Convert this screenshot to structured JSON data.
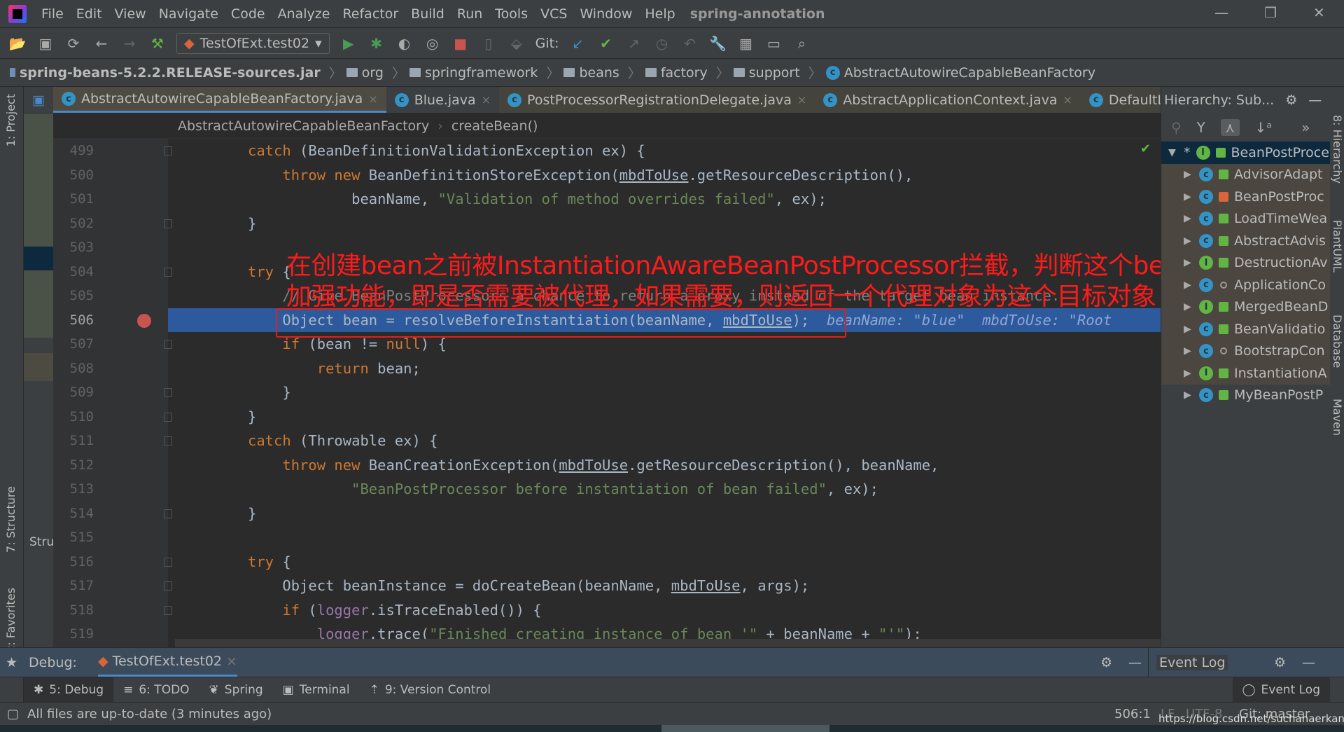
{
  "menu": {
    "items": [
      "File",
      "Edit",
      "View",
      "Navigate",
      "Code",
      "Analyze",
      "Refactor",
      "Build",
      "Run",
      "Tools",
      "VCS",
      "Window",
      "Help"
    ],
    "project": "spring-annotation"
  },
  "toolbar": {
    "run_config": "TestOfExt.test02",
    "git_label": "Git:"
  },
  "nav": {
    "crumbs": [
      "spring-beans-5.2.2.RELEASE-sources.jar",
      "org",
      "springframework",
      "beans",
      "factory",
      "support",
      "AbstractAutowireCapableBeanFactory"
    ]
  },
  "tabs": [
    {
      "label": "AbstractAutowireCapableBeanFactory.java",
      "state": "active"
    },
    {
      "label": "Blue.java",
      "state": "normal"
    },
    {
      "label": "PostProcessorRegistrationDelegate.java",
      "state": "modified"
    },
    {
      "label": "AbstractApplicationContext.java",
      "state": "modified"
    },
    {
      "label": "DefaultListab",
      "state": "modified"
    }
  ],
  "tabs_overflow": "5",
  "editor": {
    "breadcrumb": [
      "AbstractAutowireCapableBeanFactory",
      "createBean()"
    ],
    "current_line": 506,
    "lines": [
      {
        "n": 499,
        "ind": 0,
        "t": [
          [
            "catch",
            "kw"
          ],
          [
            " (BeanDefinitionValidationException ex) {",
            ""
          ]
        ]
      },
      {
        "n": 500,
        "ind": 1,
        "t": [
          [
            "throw new ",
            "kw"
          ],
          [
            "BeanDefinitionStoreException(",
            ""
          ],
          [
            "mbdToUse",
            "u"
          ],
          [
            ".getResourceDescription(),",
            ""
          ]
        ]
      },
      {
        "n": 501,
        "ind": 3,
        "t": [
          [
            "beanName, ",
            ""
          ],
          [
            "\"Validation of method overrides failed\"",
            "str"
          ],
          [
            ", ex);",
            ""
          ]
        ]
      },
      {
        "n": 502,
        "ind": 0,
        "t": [
          [
            "}",
            ""
          ]
        ]
      },
      {
        "n": 503,
        "ind": 0,
        "t": []
      },
      {
        "n": 504,
        "ind": 0,
        "t": [
          [
            "try",
            "kw"
          ],
          [
            " {",
            ""
          ]
        ]
      },
      {
        "n": 505,
        "ind": 1,
        "t": [
          [
            "// Give BeanPostProcessors a chance to return a proxy instead of the target bean instance.",
            "cm"
          ]
        ]
      },
      {
        "n": 506,
        "ind": 1,
        "t": [
          [
            "Object bean = resolveBeforeInstantiation(beanName, ",
            ""
          ],
          [
            "mbdToUse",
            "u"
          ],
          [
            ");",
            ""
          ],
          [
            "  beanName: \"blue\"  mbdToUse: \"Root",
            "hint"
          ]
        ]
      },
      {
        "n": 507,
        "ind": 1,
        "t": [
          [
            "if",
            "kw"
          ],
          [
            " (bean != ",
            ""
          ],
          [
            "null",
            "kw"
          ],
          [
            ") {",
            ""
          ]
        ]
      },
      {
        "n": 508,
        "ind": 2,
        "t": [
          [
            "return",
            "kw"
          ],
          [
            " bean;",
            ""
          ]
        ]
      },
      {
        "n": 509,
        "ind": 1,
        "t": [
          [
            "}",
            ""
          ]
        ]
      },
      {
        "n": 510,
        "ind": 0,
        "t": [
          [
            "}",
            ""
          ]
        ]
      },
      {
        "n": 511,
        "ind": 0,
        "t": [
          [
            "catch",
            "kw"
          ],
          [
            " (Throwable ex) {",
            ""
          ]
        ]
      },
      {
        "n": 512,
        "ind": 1,
        "t": [
          [
            "throw new ",
            "kw"
          ],
          [
            "BeanCreationException(",
            ""
          ],
          [
            "mbdToUse",
            "u"
          ],
          [
            ".getResourceDescription(), beanName,",
            ""
          ]
        ]
      },
      {
        "n": 513,
        "ind": 3,
        "t": [
          [
            "\"BeanPostProcessor before instantiation of bean failed\"",
            "str"
          ],
          [
            ", ex);",
            ""
          ]
        ]
      },
      {
        "n": 514,
        "ind": 0,
        "t": [
          [
            "}",
            ""
          ]
        ]
      },
      {
        "n": 515,
        "ind": 0,
        "t": []
      },
      {
        "n": 516,
        "ind": 0,
        "t": [
          [
            "try",
            "kw"
          ],
          [
            " {",
            ""
          ]
        ]
      },
      {
        "n": 517,
        "ind": 1,
        "t": [
          [
            "Object beanInstance = doCreateBean(beanName, ",
            ""
          ],
          [
            "mbdToUse",
            "u"
          ],
          [
            ", args);",
            ""
          ]
        ]
      },
      {
        "n": 518,
        "ind": 1,
        "t": [
          [
            "if",
            "kw"
          ],
          [
            " (",
            ""
          ],
          [
            "logger",
            "fld"
          ],
          [
            ".isTraceEnabled()) {",
            ""
          ]
        ]
      },
      {
        "n": 519,
        "ind": 2,
        "t": [
          [
            "logger",
            "fld"
          ],
          [
            ".trace(",
            ""
          ],
          [
            "\"Finished creating instance of bean '\"",
            "str"
          ],
          [
            " + beanName + ",
            ""
          ],
          [
            "\"'\"",
            "str"
          ],
          [
            ");",
            ""
          ]
        ]
      }
    ],
    "annotation": [
      "在创建bean之前被InstantiationAwareBeanPostProcessor拦截，判断这个bean是否需要",
      "加强功能，即是否需要被代理，如果需要，则返回一个代理对象为这个目标对象"
    ]
  },
  "hierarchy": {
    "title": "Hierarchy:",
    "scope": "Sub...",
    "items": [
      {
        "name": "BeanPostProce",
        "kind": "I",
        "access": "pub",
        "selected": true
      },
      {
        "name": "AdvisorAdapt",
        "kind": "C",
        "access": "pub"
      },
      {
        "name": "BeanPostProc",
        "kind": "C",
        "access": "priv"
      },
      {
        "name": "LoadTimeWea",
        "kind": "C",
        "access": "pub"
      },
      {
        "name": "AbstractAdvis",
        "kind": "C",
        "access": "pub"
      },
      {
        "name": "DestructionAv",
        "kind": "I",
        "access": "pub"
      },
      {
        "name": "ApplicationCo",
        "kind": "C",
        "access": "pkg"
      },
      {
        "name": "MergedBeanD",
        "kind": "I",
        "access": "pub"
      },
      {
        "name": "BeanValidatio",
        "kind": "C",
        "access": "pub"
      },
      {
        "name": "BootstrapCon",
        "kind": "C",
        "access": "pkg"
      },
      {
        "name": "InstantiationA",
        "kind": "I",
        "access": "pub"
      },
      {
        "name": "MyBeanPostP",
        "kind": "C",
        "access": "pub"
      }
    ]
  },
  "left_strip": {
    "project": "1: Project",
    "structure": "7: Structure",
    "favorites": "2: Favorites",
    "structure_short": "Stru"
  },
  "right_strip": {
    "hierarchy": "8: Hierarchy",
    "plantuml": "PlantUML",
    "database": "Database",
    "maven": "Maven"
  },
  "debug": {
    "label": "Debug:",
    "session": "TestOfExt.test02",
    "event_log": "Event Log"
  },
  "tool_windows": [
    {
      "label": "5: Debug",
      "active": true
    },
    {
      "label": "6: TODO"
    },
    {
      "label": "Spring"
    },
    {
      "label": "Terminal"
    },
    {
      "label": "9: Version Control"
    }
  ],
  "tool_event_log": "Event Log",
  "status": {
    "message": "All files are up-to-date (3 minutes ago)",
    "position": "506:1",
    "line_sep": "LF",
    "encoding": "UTF-8",
    "git": "Git: master",
    "watermark": "https://blog.csdn.net/suchahaerkang"
  }
}
